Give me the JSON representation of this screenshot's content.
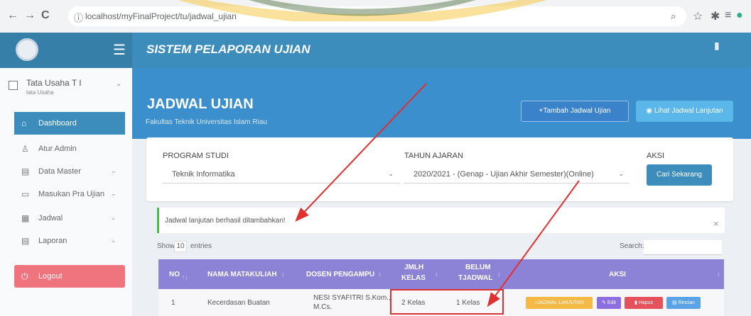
{
  "browser": {
    "url": "localhost/myFinalProject/tu/jadwal_ujian",
    "back": "←",
    "forward": "→",
    "reload": "C",
    "info": "ⓘ"
  },
  "app": {
    "title": "SISTEM PELAPORAN UJIAN"
  },
  "user": {
    "name": "Tata Usaha T I",
    "role": "tata Usaha"
  },
  "sidebar": {
    "items": [
      {
        "label": "Dashboard",
        "icon": "home-icon",
        "active": true
      },
      {
        "label": "Atur Admin",
        "icon": "user-icon"
      },
      {
        "label": "Data Master",
        "icon": "folder-icon",
        "chevron": true
      },
      {
        "label": "Masukan Pra Ujian",
        "icon": "list-icon",
        "chevron": true
      },
      {
        "label": "Jadwal",
        "icon": "table-icon",
        "chevron": true
      },
      {
        "label": "Laporan",
        "icon": "file-icon",
        "chevron": true
      },
      {
        "label": "Logout",
        "icon": "power-icon"
      }
    ]
  },
  "page": {
    "title": "JADWAL UJIAN",
    "subtitle": "Fakultas Teknik Universitas Islam Riau",
    "add_button": "+Tambah Jadwal Ujian",
    "view_button": "Lihat Jadwal Lanjutan"
  },
  "filter": {
    "prodi_label": "PROGRAM STUDI",
    "prodi_value": "Teknik Informatika",
    "tahun_label": "TAHUN AJARAN",
    "tahun_value": "2020/2021 - (Genap - Ujian Akhir Semester)(Online)",
    "aksi_label": "AKSI",
    "search_button": "Cari Sekarang"
  },
  "alert": {
    "text": "Jadwal lanjutan berhasil ditambahkan!",
    "close": "×"
  },
  "table": {
    "show_label": "Show",
    "show_value": "10",
    "entries_label": "entries",
    "search_label": "Search:",
    "headers": {
      "no": "NO",
      "matakuliah": "NAMA MATAKULIAH",
      "dosen": "DOSEN PENGAMPU",
      "jmlh_kelas_1": "JMLH",
      "jmlh_kelas_2": "KELAS",
      "belum_1": "BELUM",
      "belum_2": "TJADWAL",
      "aksi": "AKSI"
    },
    "rows": [
      {
        "no": "1",
        "matakuliah": "Kecerdasan Buatan",
        "dosen_1": "NESI SYAFITRI S.Kom.,",
        "dosen_2": "M.Cs.",
        "jmlh_kelas": "2 Kelas",
        "belum": "1 Kelas",
        "actions": [
          "+JADWAL LANJUTAN",
          "Edit",
          "Hapus",
          "Rincian"
        ]
      }
    ]
  },
  "colors": {
    "topbar": "#3c8dbc",
    "header": "#3b8fcc",
    "table_header": "#8c82d6",
    "logout": "#f0747e",
    "annotation": "#e03030"
  }
}
